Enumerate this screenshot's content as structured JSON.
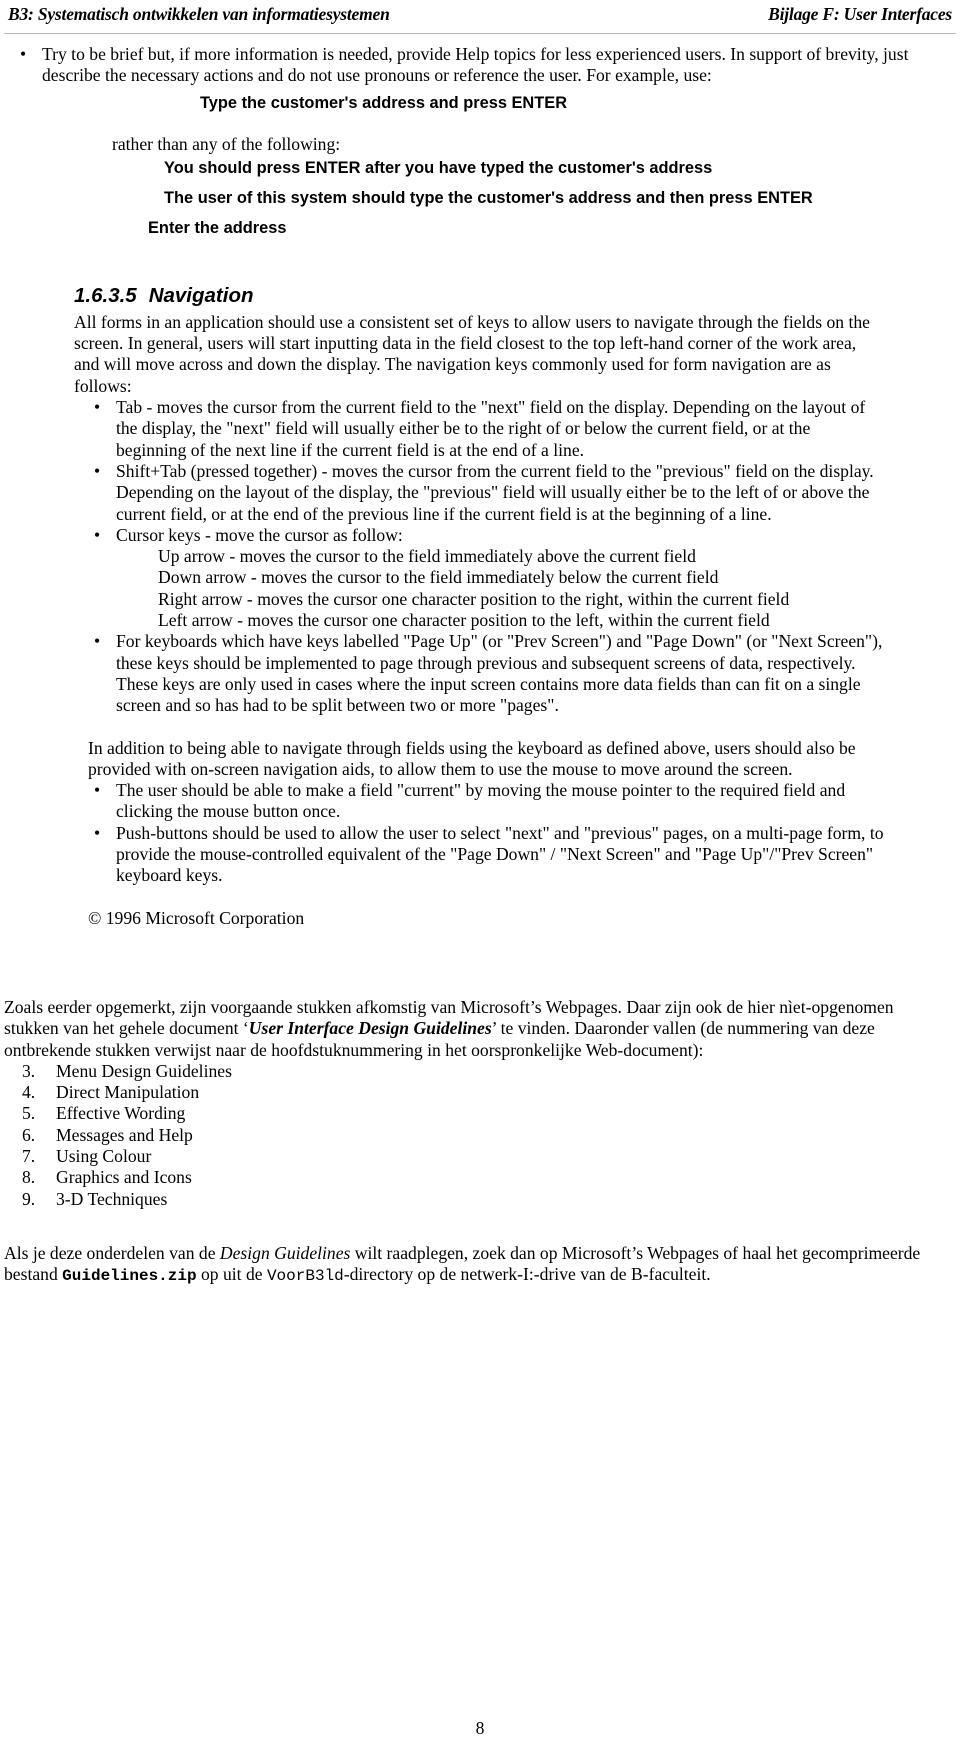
{
  "header": {
    "left": "B3: Systematisch ontwikkelen van informatiesystemen",
    "right": "Bijlage F: User Interfaces"
  },
  "body": {
    "bullet_brief": "Try to be brief but, if more information is needed, provide Help topics for less experienced users. In support of brevity, just describe the necessary actions and do not use pronouns or reference the user. For example, use:",
    "example_good": "Type the customer's address and press ENTER",
    "rather_than": "rather than any of the following:",
    "example_bad_1": "You should press ENTER after you have typed the customer's address",
    "example_bad_2": "The user of this system should type the customer's address and then press ENTER",
    "example_bad_3": "Enter the address"
  },
  "section": {
    "number": "1.6.3.5",
    "title": "Navigation",
    "intro": "All forms in an application should use a consistent set of keys to allow users to navigate through the fields on the screen. In general, users will start inputting data in the field closest to the top left-hand corner of the work area, and will move across and down the display. The navigation keys commonly used for form navigation are as follows:",
    "bullets": [
      "Tab - moves the cursor from the current field to the \"next\" field on the display. Depending on the layout of the display, the \"next\" field will usually either be to the right of or below the current field, or at the beginning of the next line if the current field is at the end of a line.",
      "Shift+Tab (pressed together) - moves the cursor from the current field to the \"previous\" field on the display. Depending on the layout of the display, the \"previous\" field will usually either be to the left of or above the current field, or at the end of the previous line if the current field is at the beginning of a line.",
      "Cursor keys - move the cursor as follow:",
      "For keyboards which have keys labelled \"Page Up\" (or \"Prev Screen\") and \"Page Down\" (or \"Next Screen\"), these keys should be implemented to page through previous and subsequent screens of data, respectively. These keys are only used in cases where the input screen contains more data fields than can fit on a single screen and so has had to be split between two or more \"pages\"."
    ],
    "cursor_keys": [
      "Up arrow - moves the cursor to the field immediately above the current field",
      "Down arrow - moves the cursor to the field immediately below the current field",
      "Right arrow - moves the cursor one character position to the right, within the current field",
      "Left arrow - moves the cursor one character position to the left, within the current field"
    ],
    "addition_para": "In addition to being able to navigate through fields using the keyboard as defined above, users should also be provided with on-screen navigation aids, to allow them to use the mouse to move around the screen.",
    "mouse_bullets": [
      "The user should be able to make a field \"current\" by moving the mouse pointer to the required field and clicking the mouse button once.",
      "Push-buttons should be used to allow the user to select \"next\" and \"previous\" pages, on a multi-page form, to provide the mouse-controlled equivalent of the \"Page Down\" / \"Next Screen\" and \"Page Up\"/\"Prev Screen\" keyboard keys."
    ],
    "copyright": "© 1996 Microsoft Corporation"
  },
  "dutch": {
    "para1_a": "Zoals eerder opgemerkt, zijn voorgaande stukken afkomstig van Microsoft’s Webpages. Daar zijn ook de hier nìet-opgenomen stukken van het gehele document ‘",
    "para1_title": "User Interface Design Guidelines",
    "para1_b": "’ te vinden. Daaronder vallen (de nummering van deze ontbrekende stukken verwijst naar de hoofdstuknummering in het oorspronkelijke Web-document):",
    "chapters": [
      {
        "n": "3.",
        "t": "Menu Design Guidelines"
      },
      {
        "n": "4.",
        "t": "Direct Manipulation"
      },
      {
        "n": "5.",
        "t": "Effective Wording"
      },
      {
        "n": "6.",
        "t": "Messages and Help"
      },
      {
        "n": "7.",
        "t": "Using Colour"
      },
      {
        "n": "8.",
        "t": "Graphics and Icons"
      },
      {
        "n": "9.",
        "t": "3-D Techniques"
      }
    ],
    "para2_a": "Als je deze onderdelen van de ",
    "para2_ital": "Design Guidelines",
    "para2_b": " wilt raadplegen, zoek dan op Microsoft’s Webpages of haal het gecomprimeerde bestand ",
    "para2_file": "Guidelines.zip",
    "para2_c": " op uit de ",
    "para2_dir": "VoorB3ld",
    "para2_d": "-directory op de netwerk-I:-drive van de B-faculteit."
  },
  "footer": {
    "page_number": "8"
  }
}
